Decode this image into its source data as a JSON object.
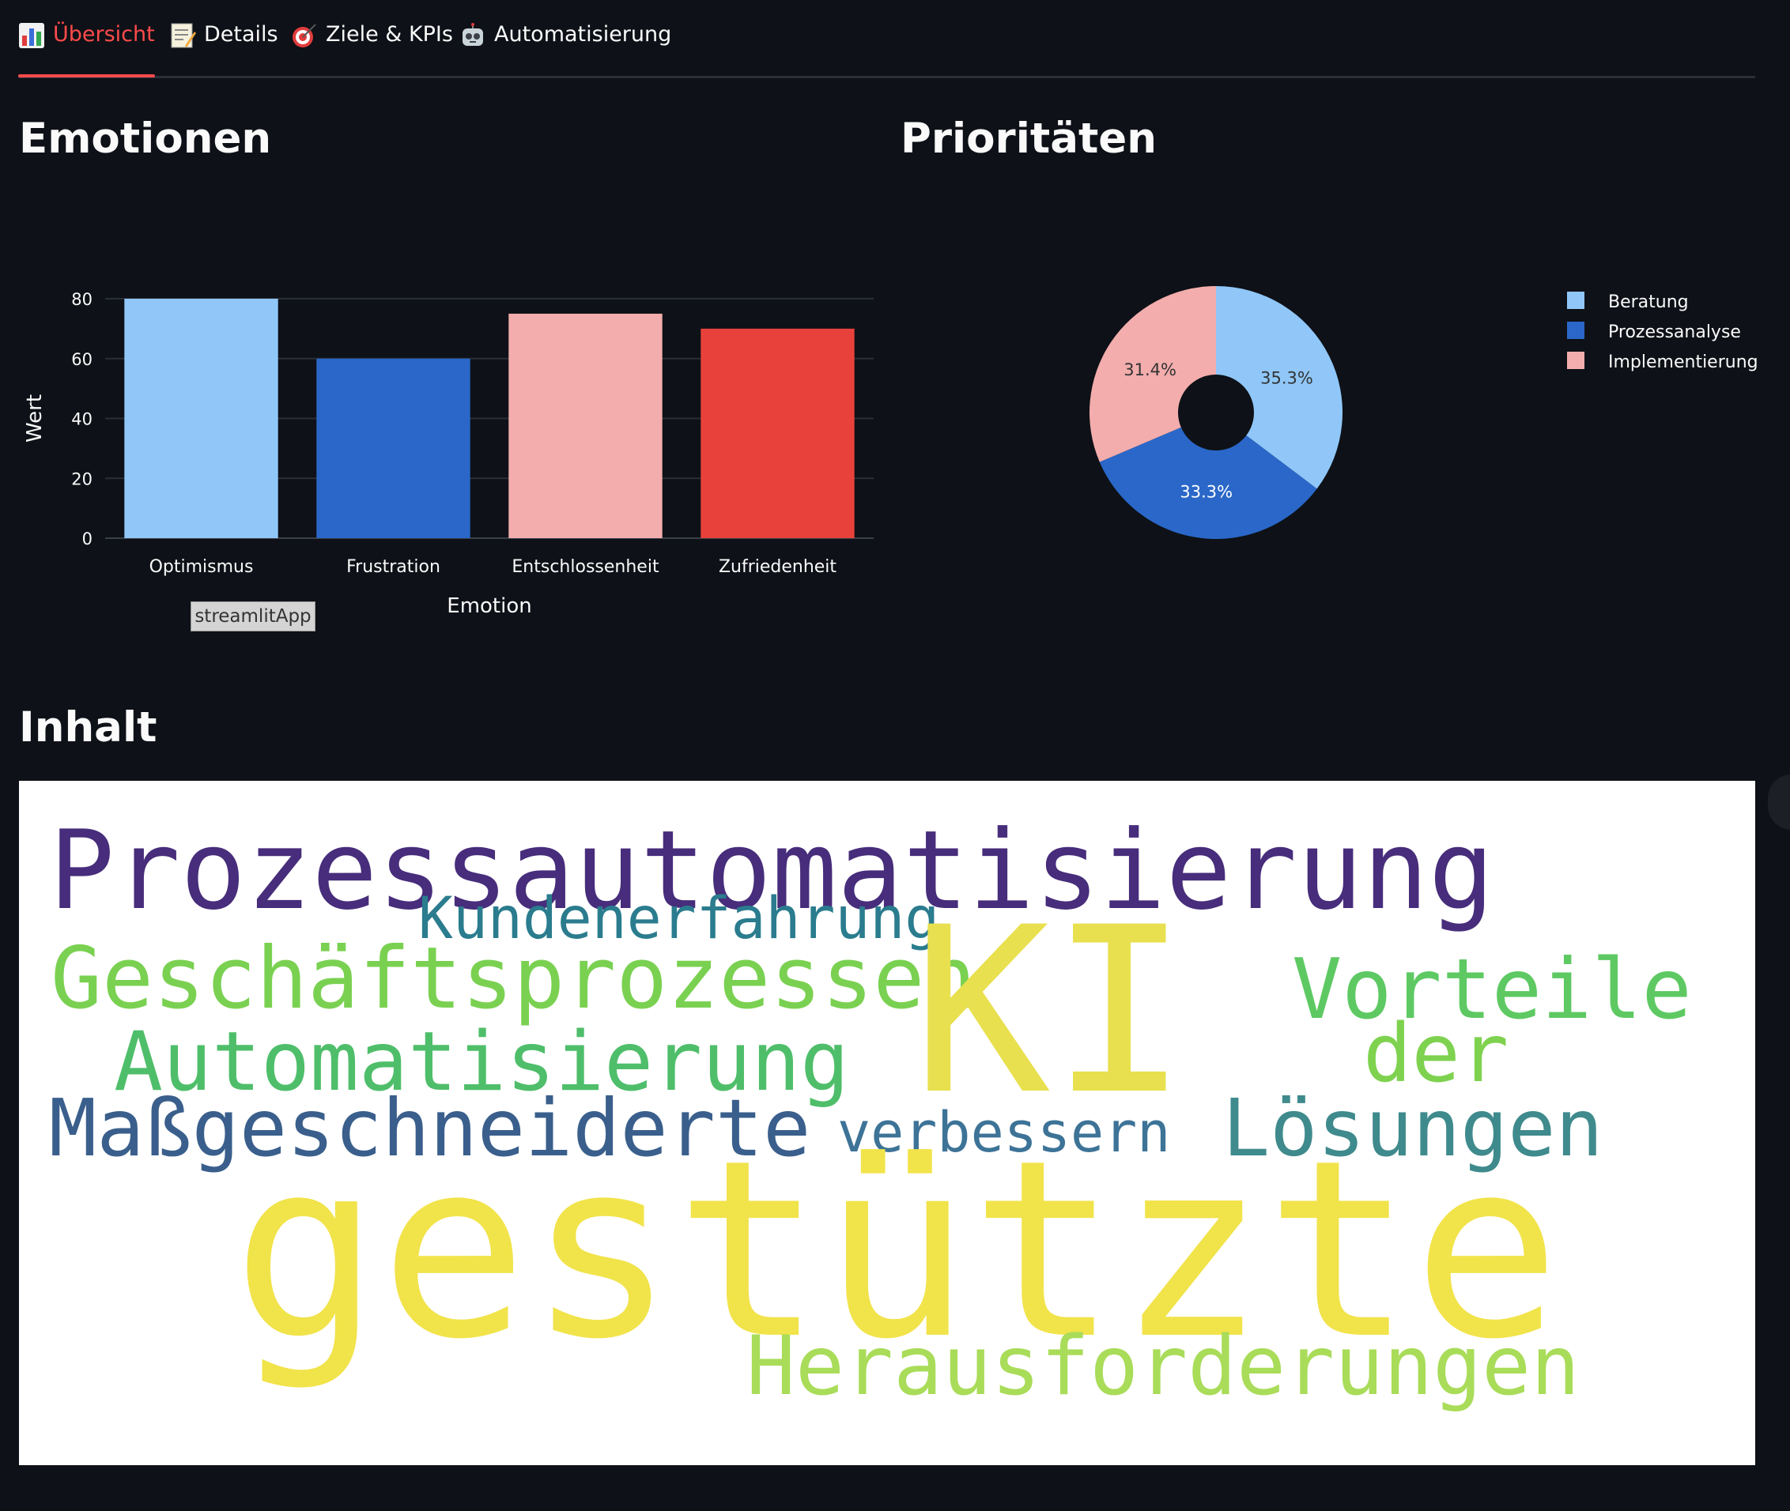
{
  "tabs": [
    {
      "label": "Übersicht",
      "icon": "bar-chart-icon",
      "active": true
    },
    {
      "label": "Details",
      "icon": "memo-icon",
      "active": false
    },
    {
      "label": "Ziele & KPIs",
      "icon": "target-icon",
      "active": false
    },
    {
      "label": "Automatisierung",
      "icon": "robot-icon",
      "active": false
    }
  ],
  "sections": {
    "emotions_title": "Emotionen",
    "priorities_title": "Prioritäten",
    "content_title": "Inhalt"
  },
  "tooltip": "streamlitApp",
  "chart_data": [
    {
      "type": "bar",
      "categories": [
        "Optimismus",
        "Frustration",
        "Entschlossenheit",
        "Zufriedenheit"
      ],
      "values": [
        80,
        60,
        75,
        70
      ],
      "colors": [
        "#90c7f8",
        "#2a67c8",
        "#f3adad",
        "#e8413b"
      ],
      "xlabel": "Emotion",
      "ylabel": "Wert",
      "ylim": [
        0,
        80
      ],
      "yticks": [
        0,
        20,
        40,
        60,
        80
      ],
      "grid": true
    },
    {
      "type": "pie",
      "hole": true,
      "labels": [
        "Beratung",
        "Prozessanalyse",
        "Implementierung"
      ],
      "values": [
        35.3,
        33.3,
        31.4
      ],
      "percent_labels": [
        "35.3%",
        "33.3%",
        "31.4%"
      ],
      "colors": [
        "#90c7f8",
        "#2a67c8",
        "#f3adad"
      ],
      "legend": "right"
    }
  ],
  "wordcloud": {
    "words": [
      {
        "text": "Prozessautomatisierung",
        "color": "#472d7b"
      },
      {
        "text": "Kundenerfahrung",
        "color": "#2a7c8e"
      },
      {
        "text": "Geschäftsprozessen",
        "color": "#7ad151"
      },
      {
        "text": "KI",
        "color": "#e8e04e"
      },
      {
        "text": "Vorteile",
        "color": "#5ec962"
      },
      {
        "text": "Automatisierung",
        "color": "#4fbe6a"
      },
      {
        "text": "der",
        "color": "#7ed24f"
      },
      {
        "text": "Maßgeschneiderte",
        "color": "#3a5f8c"
      },
      {
        "text": "verbessern",
        "color": "#3d7397"
      },
      {
        "text": "Lösungen",
        "color": "#3f8a8c"
      },
      {
        "text": "gestützte",
        "color": "#f1e34a"
      },
      {
        "text": "Herausforderungen",
        "color": "#a9dc59"
      }
    ]
  }
}
